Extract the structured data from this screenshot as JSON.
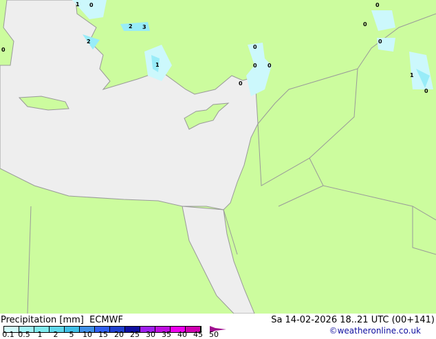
{
  "title": "Precipitation [mm]",
  "model": "ECMWF",
  "datetime": "Sa 14-02-2026 18..21 UTC (00+141)",
  "credit": "©weatheronline.co.uk",
  "colors": {
    "land": "#ccfc9e",
    "sea": "#eeeeee",
    "border": "#999999",
    "precip_light": "#ccf8fc",
    "precip_mid": "#98ecf8"
  },
  "legend": {
    "ticks": [
      "0.1",
      "0.5",
      "1",
      "2",
      "5",
      "10",
      "15",
      "20",
      "25",
      "30",
      "35",
      "40",
      "45",
      "50"
    ],
    "colors": [
      "#d0fcfc",
      "#a0f4f8",
      "#80ecf0",
      "#60d8ec",
      "#40c0e8",
      "#4090e8",
      "#3060f0",
      "#2040d0",
      "#1010a0",
      "#a020f0",
      "#c010e0",
      "#f000f0",
      "#d000b0"
    ]
  },
  "map_labels": [
    "1",
    "0",
    "2",
    "3",
    "2",
    "1",
    "0",
    "0",
    "0",
    "0",
    "0",
    "0",
    "0",
    "1",
    "0",
    "0"
  ]
}
